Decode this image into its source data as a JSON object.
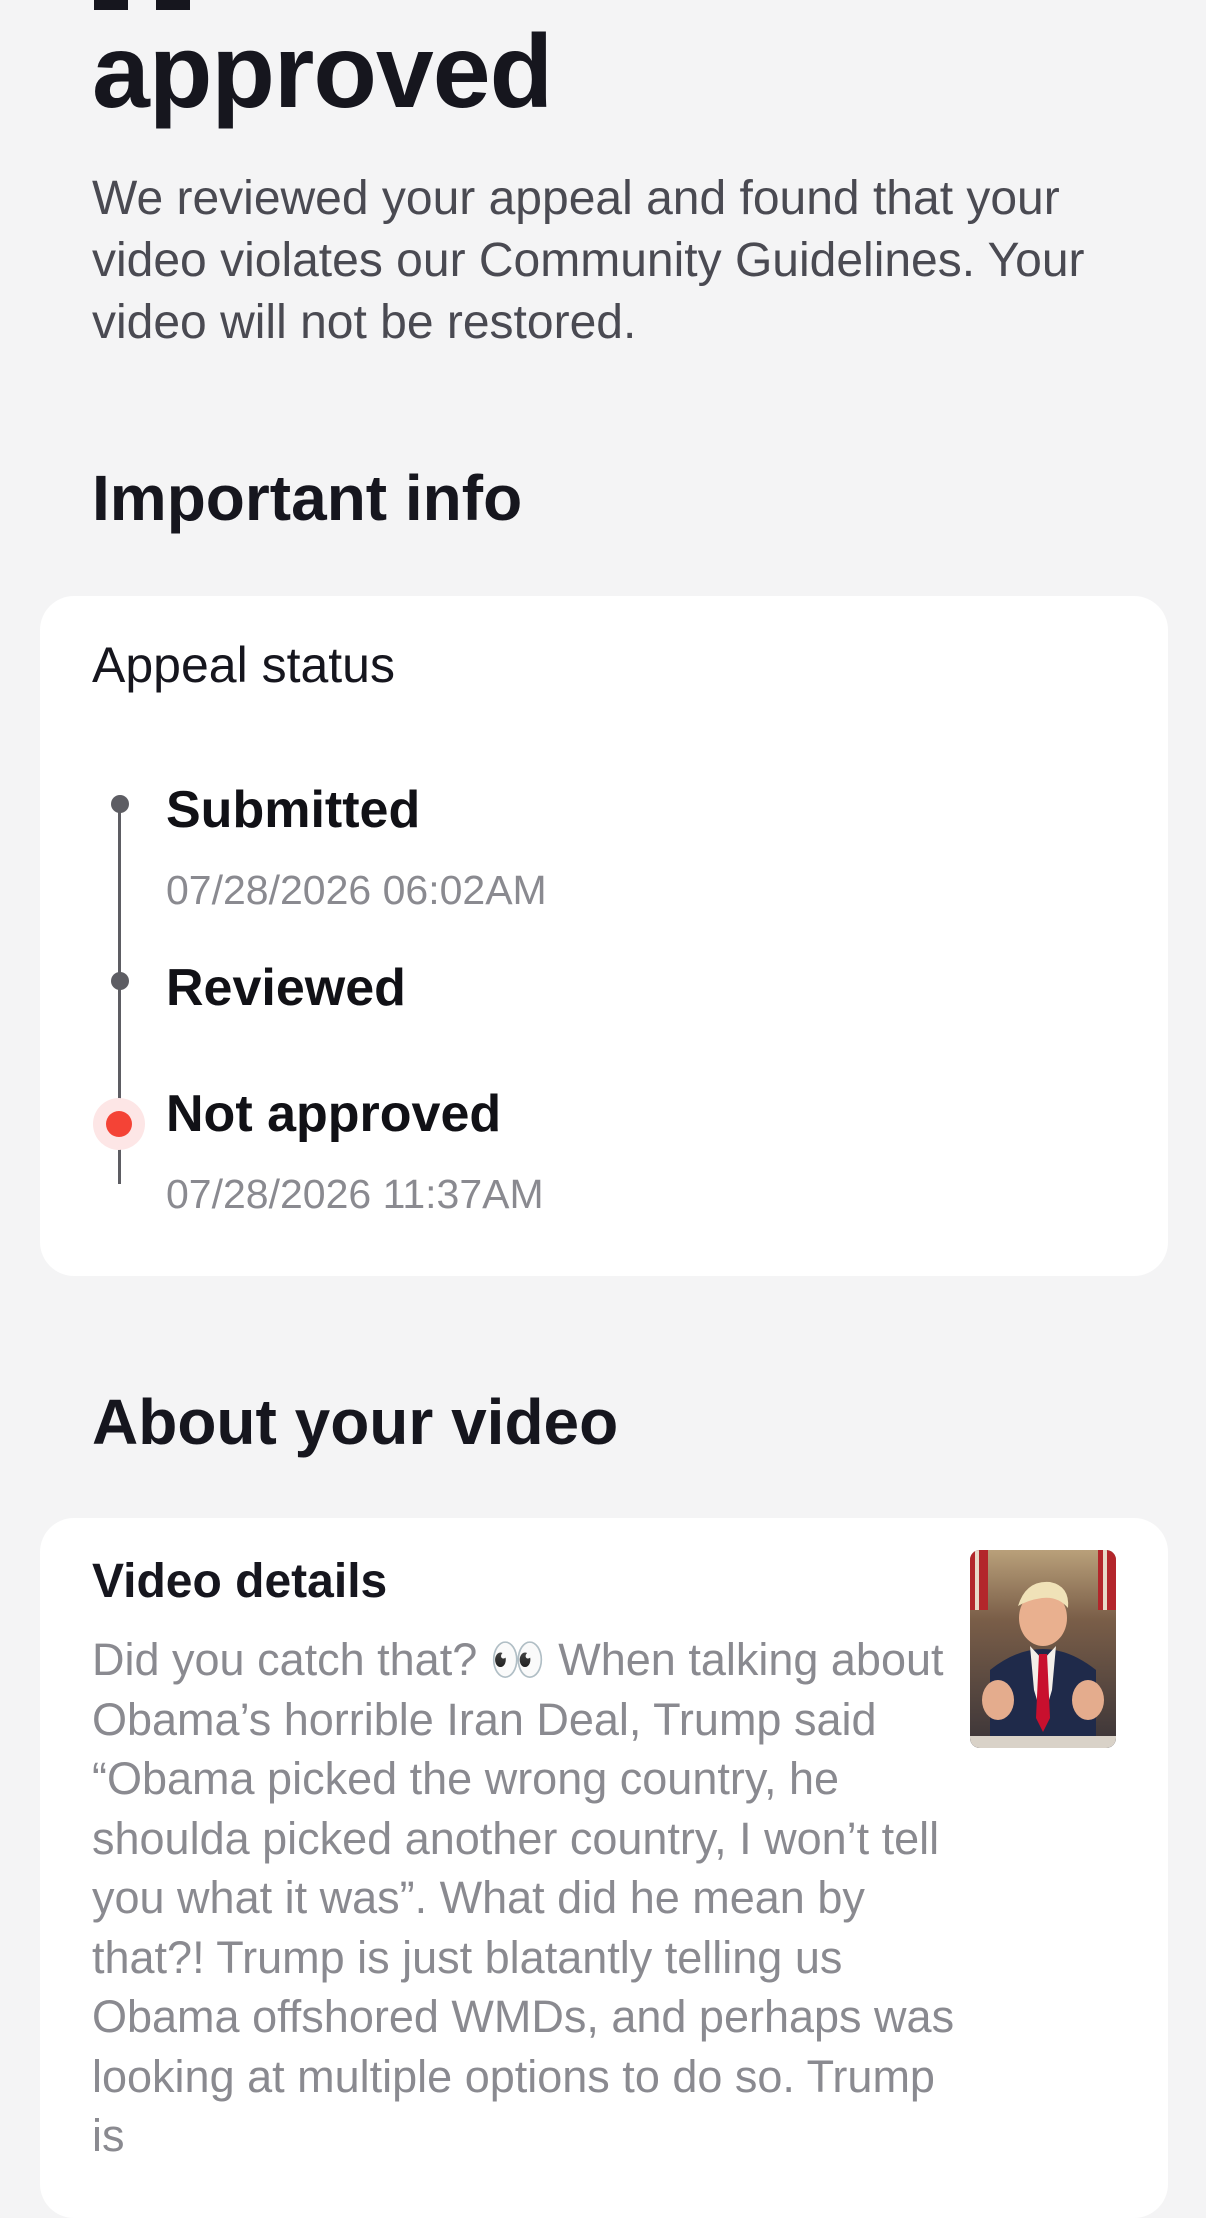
{
  "header": {
    "title_line2": "approved",
    "description": "We reviewed your appeal and found that your video violates our Community Guidelines. Your video will not be restored."
  },
  "important_info": {
    "section_title": "Important info",
    "card_title": "Appeal status",
    "steps": [
      {
        "label": "Submitted",
        "time": "07/28/2026 06:02AM",
        "status": "done"
      },
      {
        "label": "Reviewed",
        "time": "",
        "status": "done"
      },
      {
        "label": "Not approved",
        "time": "07/28/2026 11:37AM",
        "status": "rejected"
      }
    ]
  },
  "about_video": {
    "section_title": "About your video",
    "card_title": "Video details",
    "description": "Did you catch that? 👀 When talking about Obama’s horrible Iran Deal, Trump said “Obama picked the wrong country, he shoulda picked another country, I won’t tell you what it was”. What did he mean by that?! Trump is just blatantly telling us Obama offshored WMDs, and perhaps was looking at multiple options to do so. Trump is"
  },
  "colors": {
    "background": "#f4f4f5",
    "card": "#ffffff",
    "rejected_dot": "#f44336",
    "timeline": "#5d5d63",
    "secondary_text": "#8a8a90"
  }
}
